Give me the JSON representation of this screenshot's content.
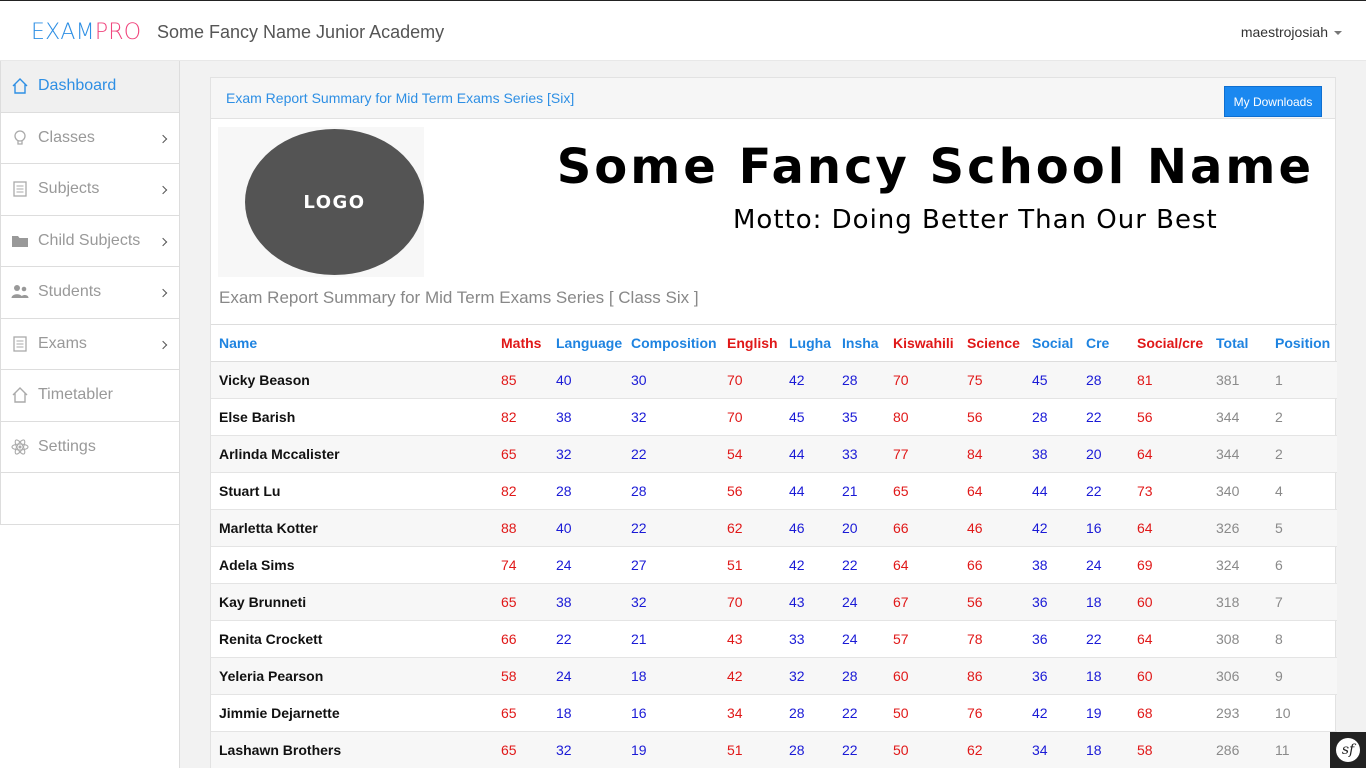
{
  "brand": {
    "part1": "EXAM",
    "part2": "PRO"
  },
  "header": {
    "school_name": "Some Fancy Name Junior Academy",
    "user": "maestrojosiah"
  },
  "sidebar": {
    "items": [
      {
        "label": "Dashboard",
        "icon": "home-icon",
        "active": true
      },
      {
        "label": "Classes",
        "icon": "lightbulb-icon"
      },
      {
        "label": "Subjects",
        "icon": "document-icon"
      },
      {
        "label": "Child Subjects",
        "icon": "folder-icon"
      },
      {
        "label": "Students",
        "icon": "users-icon"
      },
      {
        "label": "Exams",
        "icon": "document-icon"
      },
      {
        "label": "Timetabler",
        "icon": "home-icon"
      },
      {
        "label": "Settings",
        "icon": "atom-icon"
      }
    ]
  },
  "panel": {
    "title": "Exam Report Summary for Mid Term Exams Series [Six]",
    "download_label": "My Downloads"
  },
  "banner": {
    "logo_text": "LOGO",
    "school_name": "Some Fancy School Name",
    "motto": "Motto: Doing Better Than Our Best"
  },
  "report": {
    "subtitle": "Exam Report Summary for Mid Term Exams Series [ Class Six ]"
  },
  "table": {
    "headers": [
      "Name",
      "Maths",
      "Language",
      "Composition",
      "English",
      "Lugha",
      "Insha",
      "Kiswahili",
      "Science",
      "Social",
      "Cre",
      "Social/cre",
      "Total",
      "Position"
    ],
    "rows": [
      [
        "Vicky Beason",
        "85",
        "40",
        "30",
        "70",
        "42",
        "28",
        "70",
        "75",
        "45",
        "28",
        "81",
        "381",
        "1"
      ],
      [
        "Else Barish",
        "82",
        "38",
        "32",
        "70",
        "45",
        "35",
        "80",
        "56",
        "28",
        "22",
        "56",
        "344",
        "2"
      ],
      [
        "Arlinda Mccalister",
        "65",
        "32",
        "22",
        "54",
        "44",
        "33",
        "77",
        "84",
        "38",
        "20",
        "64",
        "344",
        "2"
      ],
      [
        "Stuart Lu",
        "82",
        "28",
        "28",
        "56",
        "44",
        "21",
        "65",
        "64",
        "44",
        "22",
        "73",
        "340",
        "4"
      ],
      [
        "Marletta Kotter",
        "88",
        "40",
        "22",
        "62",
        "46",
        "20",
        "66",
        "46",
        "42",
        "16",
        "64",
        "326",
        "5"
      ],
      [
        "Adela Sims",
        "74",
        "24",
        "27",
        "51",
        "42",
        "22",
        "64",
        "66",
        "38",
        "24",
        "69",
        "324",
        "6"
      ],
      [
        "Kay Brunneti",
        "65",
        "38",
        "32",
        "70",
        "43",
        "24",
        "67",
        "56",
        "36",
        "18",
        "60",
        "318",
        "7"
      ],
      [
        "Renita Crockett",
        "66",
        "22",
        "21",
        "43",
        "33",
        "24",
        "57",
        "78",
        "36",
        "22",
        "64",
        "308",
        "8"
      ],
      [
        "Yeleria Pearson",
        "58",
        "24",
        "18",
        "42",
        "32",
        "28",
        "60",
        "86",
        "36",
        "18",
        "60",
        "306",
        "9"
      ],
      [
        "Jimmie Dejarnette",
        "65",
        "18",
        "16",
        "34",
        "28",
        "22",
        "50",
        "76",
        "42",
        "19",
        "68",
        "293",
        "10"
      ],
      [
        "Lashawn Brothers",
        "65",
        "32",
        "19",
        "51",
        "28",
        "22",
        "50",
        "62",
        "34",
        "18",
        "58",
        "286",
        "11"
      ]
    ]
  },
  "colors": {
    "accent": "#2e8fe4",
    "brand_pink": "#f0457d",
    "red_subject": "#e01818",
    "blue_subject": "#1a1ad6",
    "button": "#1a88f0"
  },
  "toolbar": {
    "icon": "symfony-icon",
    "label": "sf"
  }
}
